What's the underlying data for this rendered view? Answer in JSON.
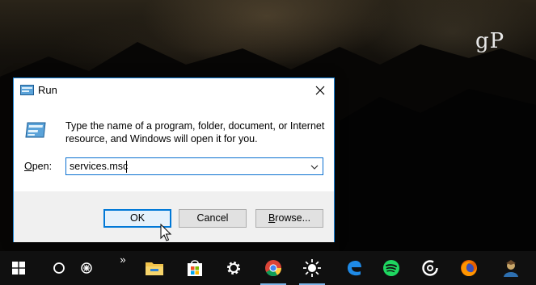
{
  "watermark": "gP",
  "dialog": {
    "title": "Run",
    "description": "Type the name of a program, folder, document, or Internet resource, and Windows will open it for you.",
    "open_label_accel": "O",
    "open_label_rest": "pen:",
    "open_value": "services.msc",
    "ok_label": "OK",
    "cancel_label": "Cancel",
    "browse_label_accel": "B",
    "browse_label_rest": "rowse..."
  },
  "taskbar": {
    "chevron": "»",
    "items": [
      "start-icon",
      "cortana-icon",
      "task-view-icon",
      "file-explorer-icon",
      "store-icon",
      "settings-icon",
      "chrome-icon",
      "brightness-app-icon",
      "edge-icon",
      "spotify-icon",
      "groove-icon",
      "firefox-icon",
      "user-app-icon"
    ],
    "accent": "#7ab4e6"
  },
  "colors": {
    "dialog_border": "#1883d7",
    "ok_border": "#0078d7",
    "taskbar_bg": "#101010"
  }
}
